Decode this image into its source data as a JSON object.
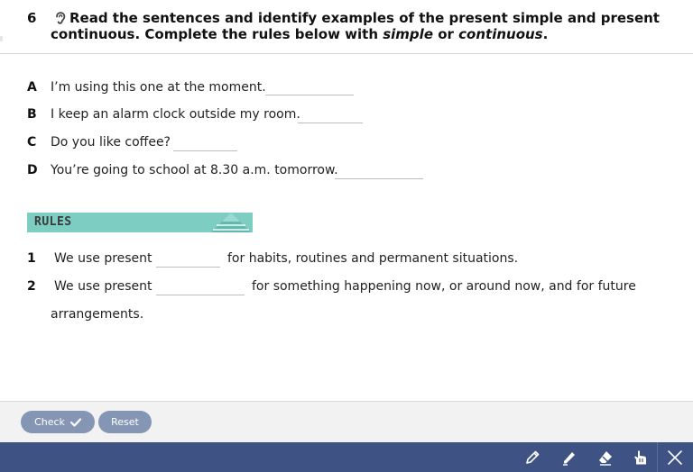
{
  "exercise": {
    "number": "6",
    "instruction_pre": "Read the sentences and identify examples of the present simple and present continuous. Complete the rules below with ",
    "instruction_em1": "simple",
    "instruction_mid": " or ",
    "instruction_em2": "continuous",
    "instruction_post": "."
  },
  "sentences": [
    {
      "letter": "A",
      "text": "I’m using this one at the moment.",
      "answer": ""
    },
    {
      "letter": "B",
      "text": "I keep an alarm clock outside my room.",
      "answer": ""
    },
    {
      "letter": "C",
      "text": "Do you like coffee?",
      "answer": ""
    },
    {
      "letter": "D",
      "text": "You’re going to school at 8.30 a.m. tomorrow.",
      "answer": ""
    }
  ],
  "rules": {
    "banner_label": "RULES",
    "items": [
      {
        "number": "1",
        "before": "We use present",
        "after": "for habits, routines and permanent situations.",
        "answer": ""
      },
      {
        "number": "2",
        "before": "We use present",
        "after": "for something happening now, or around now, and for future",
        "continuation": "arrangements.",
        "answer": ""
      }
    ]
  },
  "footer": {
    "check_label": "Check",
    "reset_label": "Reset"
  },
  "toolbar": {
    "tools": [
      "pencil-icon",
      "highlighter-icon",
      "eraser-icon",
      "hand-pointer-icon",
      "close-icon"
    ]
  },
  "colors": {
    "toolbar_bg": "#3e5383",
    "button_bg": "#8596b5",
    "rules_banner": "#7ecdc3"
  }
}
